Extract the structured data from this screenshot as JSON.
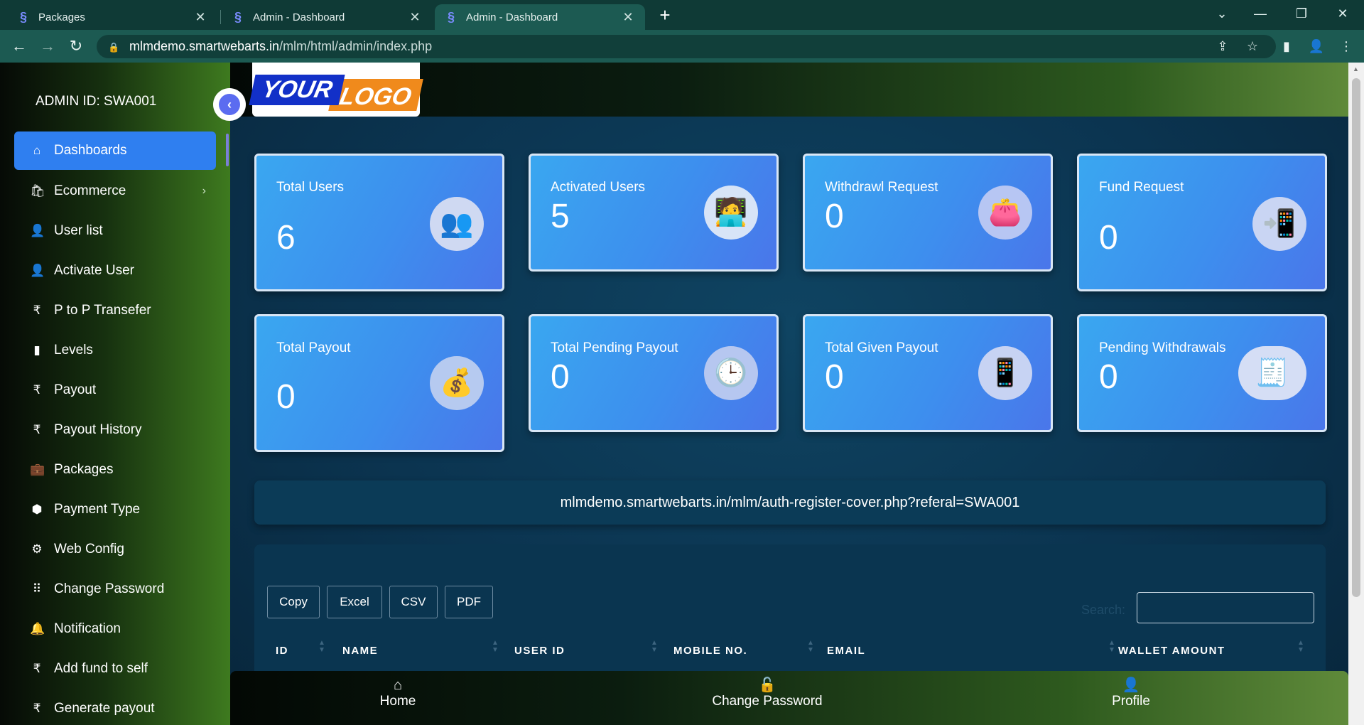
{
  "browser": {
    "tabs": [
      {
        "title": "Packages",
        "active": false
      },
      {
        "title": "Admin - Dashboard",
        "active": false
      },
      {
        "title": "Admin - Dashboard",
        "active": true
      }
    ],
    "url_host": "mlmdemo.smartwebarts.in",
    "url_path": "/mlm/html/admin/index.php",
    "icons": {
      "back": "←",
      "forward": "→",
      "reload": "↻",
      "lock": "🔒",
      "share": "⇪",
      "star": "☆",
      "sidepanel": "▮",
      "profile": "👤",
      "menu": "⋮",
      "close": "✕",
      "new_tab": "+",
      "minimize": "—",
      "restore": "❐",
      "dropdown": "⌄"
    }
  },
  "sidebar": {
    "admin_id": "ADMIN ID: SWA001",
    "collapse_icon": "‹",
    "items": [
      {
        "label": "Dashboards",
        "icon": "⌂",
        "active": true
      },
      {
        "label": "Ecommerce",
        "icon": "🛍",
        "has_submenu": true
      },
      {
        "label": "User list",
        "icon": "👤"
      },
      {
        "label": "Activate User",
        "icon": "👤"
      },
      {
        "label": "P to P Transefer",
        "icon": "₹"
      },
      {
        "label": "Levels",
        "icon": "▮"
      },
      {
        "label": "Payout",
        "icon": "₹"
      },
      {
        "label": "Payout History",
        "icon": "₹"
      },
      {
        "label": "Packages",
        "icon": "💼"
      },
      {
        "label": "Payment Type",
        "icon": "⬢"
      },
      {
        "label": "Web Config",
        "icon": "⚙"
      },
      {
        "label": "Change Password",
        "icon": "⠿"
      },
      {
        "label": "Notification",
        "icon": "🔔"
      },
      {
        "label": "Add fund to self",
        "icon": "₹"
      },
      {
        "label": "Generate payout",
        "icon": "₹"
      }
    ]
  },
  "logo": {
    "word1": "YOUR",
    "word2": "LOGO"
  },
  "cards": [
    {
      "title": "Total Users",
      "value": "6",
      "icon": "👥"
    },
    {
      "title": "Activated Users",
      "value": "5",
      "icon": "🧑‍💻"
    },
    {
      "title": "Withdrawl Request",
      "value": "0",
      "icon": "👛"
    },
    {
      "title": "Fund Request",
      "value": "0",
      "icon": "📲"
    },
    {
      "title": "Total Payout",
      "value": "0",
      "icon": "💰"
    },
    {
      "title": "Total Pending Payout",
      "value": "0",
      "icon": "🕒"
    },
    {
      "title": "Total Given Payout",
      "value": "0",
      "icon": "📱"
    },
    {
      "title": "Pending Withdrawals",
      "value": "0",
      "icon": "🧾"
    }
  ],
  "referral_link": "mlmdemo.smartwebarts.in/mlm/auth-register-cover.php?referal=SWA001",
  "table": {
    "buttons": [
      "Copy",
      "Excel",
      "CSV",
      "PDF"
    ],
    "search_label": "Search:",
    "search_value": "",
    "columns": [
      "ID",
      "NAME",
      "USER ID",
      "MOBILE NO.",
      "EMAIL",
      "WALLET AMOUNT"
    ]
  },
  "bottom_nav": [
    {
      "label": "Home",
      "icon": "⌂"
    },
    {
      "label": "Change Password",
      "icon": "🔓"
    },
    {
      "label": "Profile",
      "icon": "👤"
    }
  ]
}
